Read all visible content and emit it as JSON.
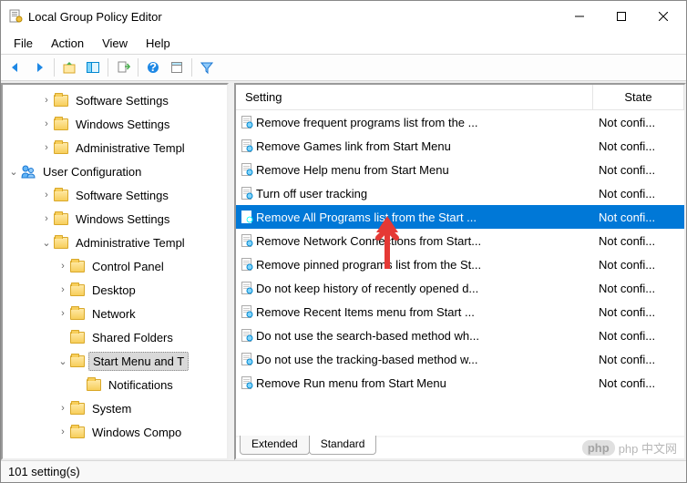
{
  "window": {
    "title": "Local Group Policy Editor"
  },
  "menu": {
    "file": "File",
    "action": "Action",
    "view": "View",
    "help": "Help"
  },
  "tree": [
    {
      "indent": 2,
      "exp": "›",
      "icon": "folder",
      "label": "Software Settings"
    },
    {
      "indent": 2,
      "exp": "›",
      "icon": "folder",
      "label": "Windows Settings"
    },
    {
      "indent": 2,
      "exp": "›",
      "icon": "folder",
      "label": "Administrative Templ"
    },
    {
      "indent": 0,
      "exp": "⌄",
      "icon": "user",
      "label": "User Configuration"
    },
    {
      "indent": 2,
      "exp": "›",
      "icon": "folder",
      "label": "Software Settings"
    },
    {
      "indent": 2,
      "exp": "›",
      "icon": "folder",
      "label": "Windows Settings"
    },
    {
      "indent": 2,
      "exp": "⌄",
      "icon": "folder",
      "label": "Administrative Templ"
    },
    {
      "indent": 3,
      "exp": "›",
      "icon": "folder",
      "label": "Control Panel"
    },
    {
      "indent": 3,
      "exp": "›",
      "icon": "folder",
      "label": "Desktop"
    },
    {
      "indent": 3,
      "exp": "›",
      "icon": "folder",
      "label": "Network"
    },
    {
      "indent": 3,
      "exp": "",
      "icon": "folder",
      "label": "Shared Folders"
    },
    {
      "indent": 3,
      "exp": "⌄",
      "icon": "folder",
      "label": "Start Menu and T",
      "selected": true
    },
    {
      "indent": 4,
      "exp": "",
      "icon": "folder",
      "label": "Notifications"
    },
    {
      "indent": 3,
      "exp": "›",
      "icon": "folder",
      "label": "System"
    },
    {
      "indent": 3,
      "exp": "›",
      "icon": "folder",
      "label": "Windows Compo"
    }
  ],
  "columns": {
    "setting": "Setting",
    "state": "State"
  },
  "rows": [
    {
      "setting": "Remove frequent programs list from the ...",
      "state": "Not confi..."
    },
    {
      "setting": "Remove Games link from Start Menu",
      "state": "Not confi..."
    },
    {
      "setting": "Remove Help menu from Start Menu",
      "state": "Not confi..."
    },
    {
      "setting": "Turn off user tracking",
      "state": "Not confi..."
    },
    {
      "setting": "Remove All Programs list from the Start ...",
      "state": "Not confi...",
      "selected": true
    },
    {
      "setting": "Remove Network Connections from Start...",
      "state": "Not confi..."
    },
    {
      "setting": "Remove pinned programs list from the St...",
      "state": "Not confi..."
    },
    {
      "setting": "Do not keep history of recently opened d...",
      "state": "Not confi..."
    },
    {
      "setting": "Remove Recent Items menu from Start ...",
      "state": "Not confi..."
    },
    {
      "setting": "Do not use the search-based method wh...",
      "state": "Not confi..."
    },
    {
      "setting": "Do not use the tracking-based method w...",
      "state": "Not confi..."
    },
    {
      "setting": "Remove Run menu from Start Menu",
      "state": "Not confi..."
    }
  ],
  "tabs": {
    "extended": "Extended",
    "standard": "Standard"
  },
  "status": "101 setting(s)",
  "watermark": "php 中文网"
}
